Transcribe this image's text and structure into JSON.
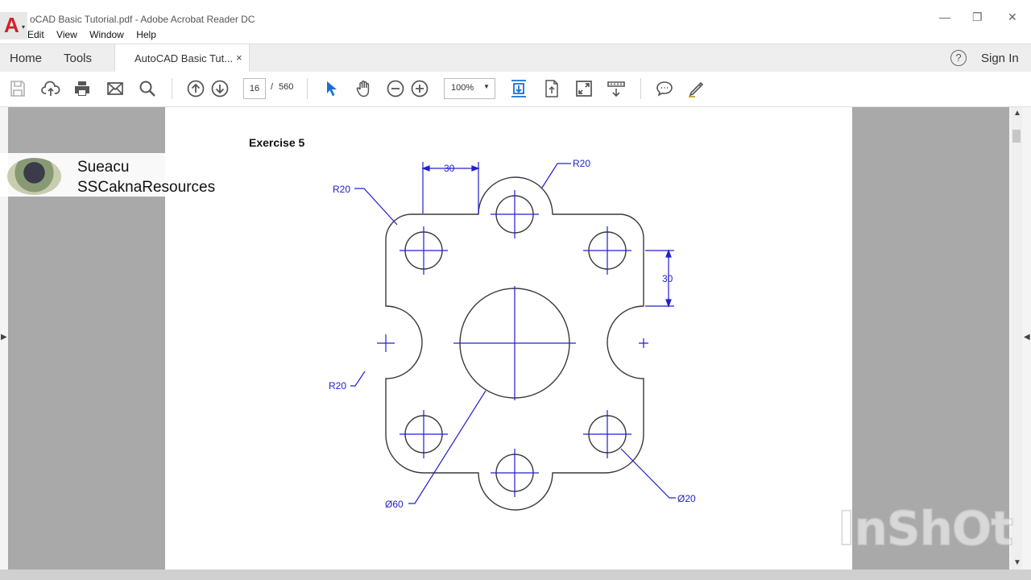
{
  "window": {
    "title": "oCAD Basic Tutorial.pdf - Adobe Acrobat Reader DC",
    "minimize": "—",
    "restore": "❐",
    "close": "✕"
  },
  "menu": [
    "Edit",
    "View",
    "Window",
    "Help"
  ],
  "tabs": {
    "home": "Home",
    "tools": "Tools",
    "document": "AutoCAD Basic Tut...",
    "close": "×"
  },
  "header": {
    "help": "?",
    "sign_in": "Sign In"
  },
  "toolbar": {
    "page_current": "16",
    "page_separator": "/",
    "page_total": "560",
    "zoom": "100%"
  },
  "document": {
    "exercise_title": "Exercise 5",
    "dimensions": [
      "30",
      "R20",
      "R20",
      "30",
      "R20",
      "Ø60",
      "Ø20"
    ]
  },
  "overlay": {
    "name": "Sueacu",
    "channel": "SSCaknaResources"
  },
  "watermark": "InShOt",
  "colors": {
    "dimension": "#2020d0",
    "outline": "#3a3a3a",
    "accent": "#1a6fd4"
  }
}
